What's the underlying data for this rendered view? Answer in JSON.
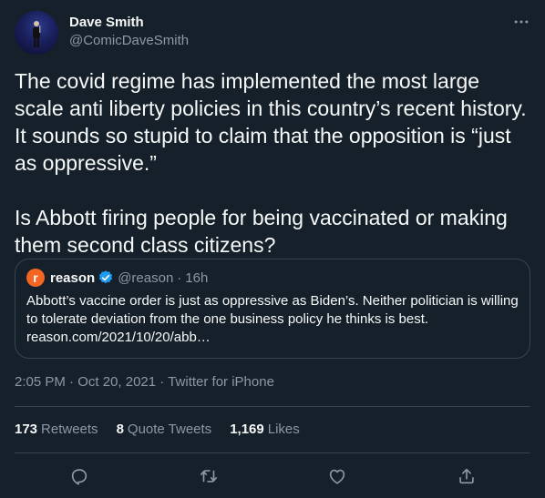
{
  "author": {
    "display_name": "Dave Smith",
    "handle": "@ComicDaveSmith"
  },
  "tweet": {
    "text": "The covid regime has implemented the most large scale anti liberty policies in this country’s recent history. It sounds so stupid to claim that the opposition is “just as oppressive.”\n\nIs Abbott firing people for being vaccinated or making them second class citizens?"
  },
  "quoted": {
    "logo_letter": "r",
    "name": "reason",
    "handle": "@reason",
    "time": "16h",
    "text": "Abbott’s vaccine order is just as oppressive as Biden’s. Neither politician is willing to tolerate deviation from the one business policy he thinks is best.",
    "link": "reason.com/2021/10/20/abb…"
  },
  "meta": {
    "time": "2:05 PM",
    "date": "Oct 20, 2021",
    "source": "Twitter for iPhone"
  },
  "stats": {
    "retweets_count": "173",
    "retweets_label": "Retweets",
    "quotes_count": "8",
    "quotes_label": "Quote Tweets",
    "likes_count": "1,169",
    "likes_label": "Likes"
  },
  "colors": {
    "background": "#15202b",
    "text": "#f7f9f9",
    "muted": "#8b98a5",
    "border": "#38444d",
    "verified": "#1d9bf0",
    "reason_brand": "#f26522"
  },
  "icons": [
    "more-icon",
    "verified-icon",
    "reply-icon",
    "retweet-icon",
    "like-icon",
    "share-icon"
  ]
}
